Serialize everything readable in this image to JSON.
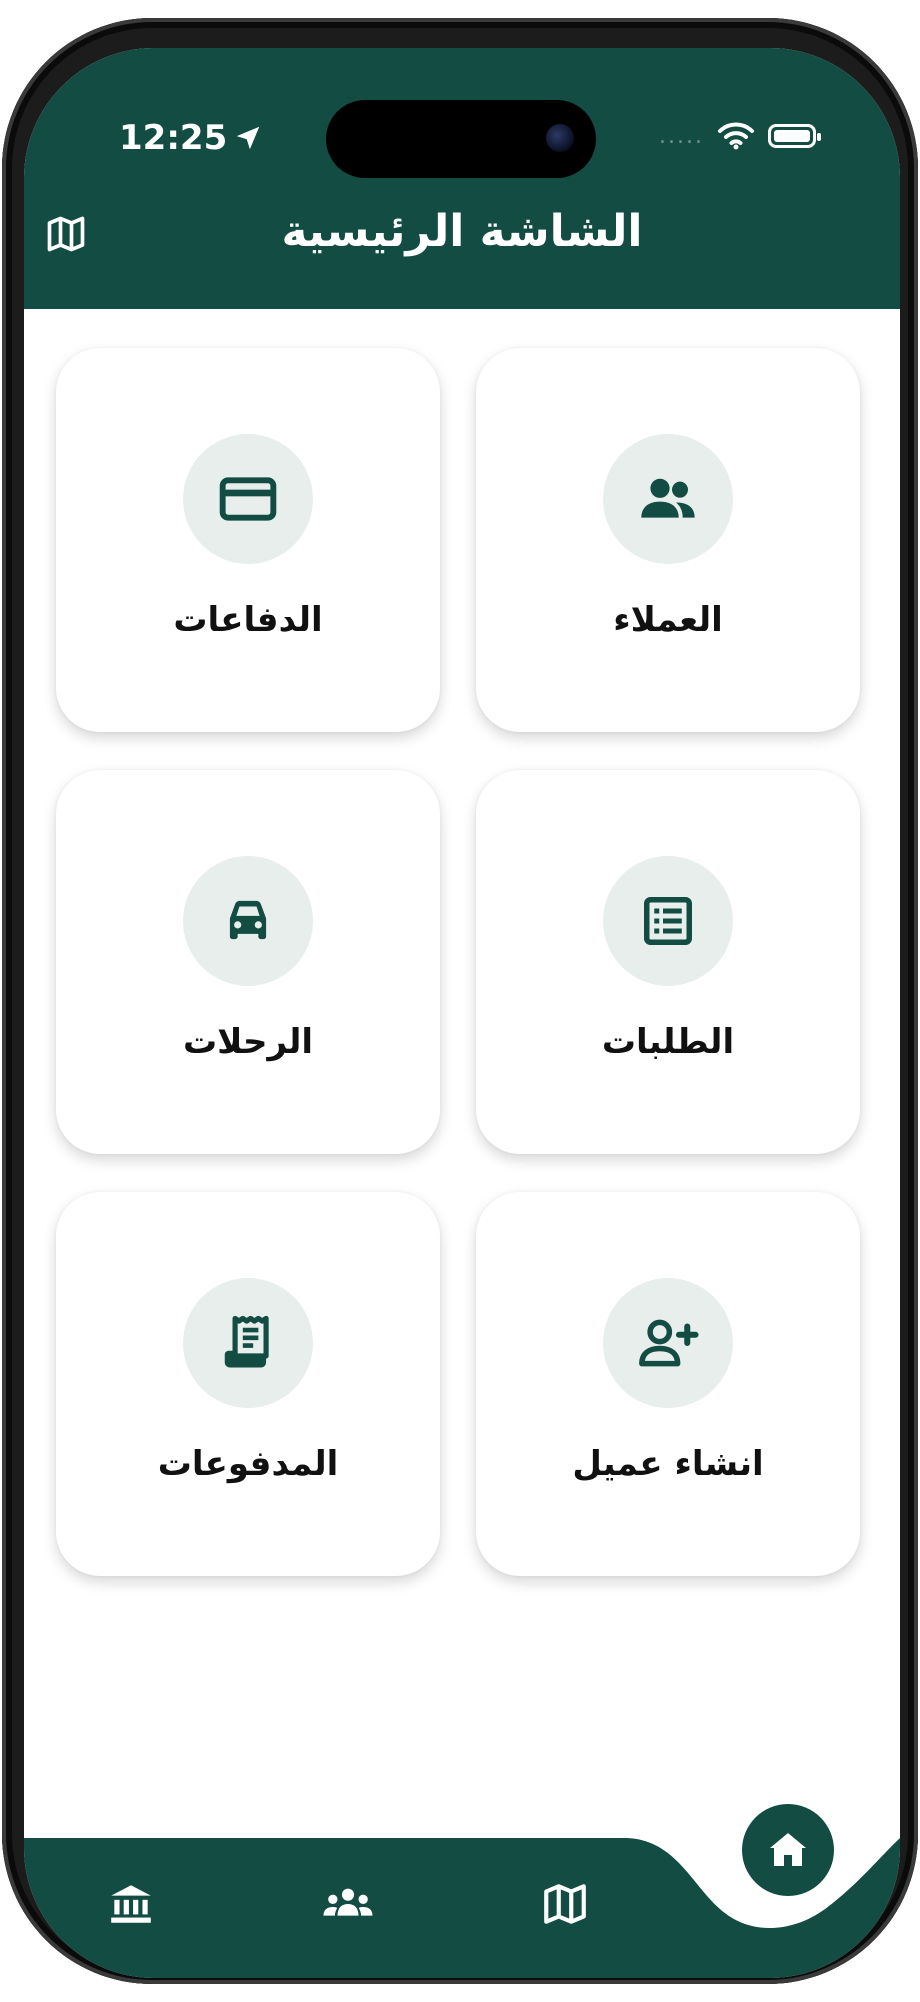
{
  "status_bar": {
    "time": "12:25",
    "signal": "....."
  },
  "header": {
    "title": "الشاشة الرئيسية",
    "map_icon": "map-icon"
  },
  "tiles": [
    {
      "label": "العملاء",
      "icon": "people-icon"
    },
    {
      "label": "الدفاعات",
      "icon": "credit-card-icon"
    },
    {
      "label": "الطلبات",
      "icon": "list-icon"
    },
    {
      "label": "الرحلات",
      "icon": "car-icon"
    },
    {
      "label": "انشاء عميل",
      "icon": "person-add-icon"
    },
    {
      "label": "المدفوعات",
      "icon": "receipt-icon"
    }
  ],
  "bottom_nav": {
    "items": [
      "bank-icon",
      "groups-icon",
      "map-icon",
      "home-icon"
    ],
    "active": "home-icon"
  },
  "colors": {
    "brand": "#124c43",
    "tile_circle": "#e8eeec",
    "background": "#ffffff"
  }
}
